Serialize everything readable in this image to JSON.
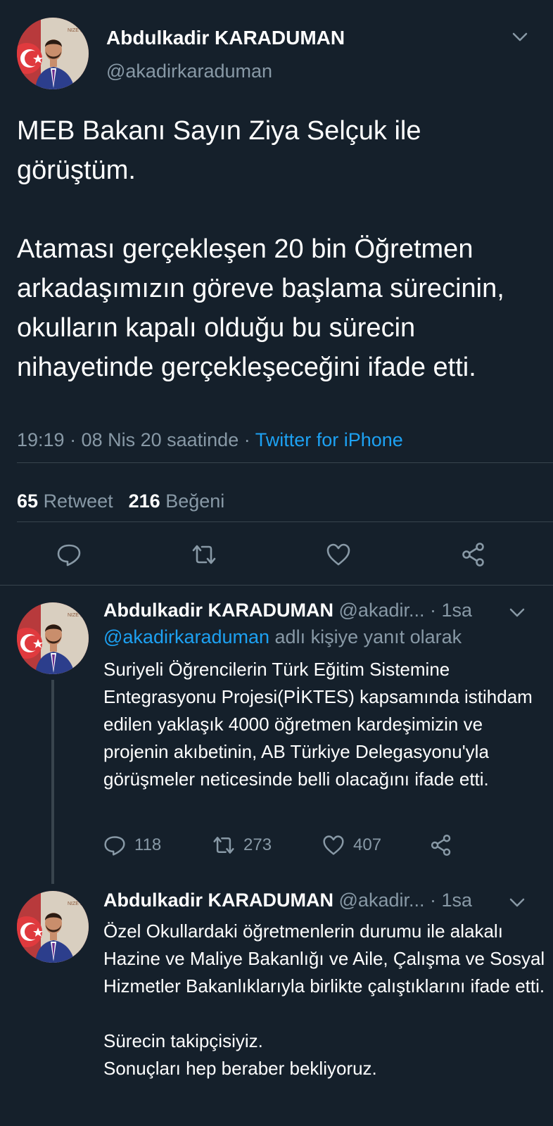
{
  "colors": {
    "background": "#15202b",
    "text_primary": "#ffffff",
    "text_secondary": "#8899a6",
    "link": "#1da1f2",
    "divider": "#38444d"
  },
  "main_tweet": {
    "author_name": "Abdulkadir KARADUMAN",
    "author_handle": "@akadirkaraduman",
    "text_paragraph_1": "MEB Bakanı Sayın Ziya Selçuk ile görüştüm.",
    "text_paragraph_2": "Ataması gerçekleşen 20 bin Öğretmen arkadaşımızın göreve başlama sürecinin, okulların kapalı olduğu bu sürecin nihayetinde gerçekleşeceğini ifade etti.",
    "timestamp": "19:19 · 08 Nis 20 saatinde · ",
    "source": "Twitter for iPhone",
    "retweet_count": "65",
    "retweet_label": "Retweet",
    "like_count": "216",
    "like_label": "Beğeni",
    "icons": [
      "reply-icon",
      "retweet-icon",
      "like-icon",
      "share-icon",
      "chevron-down-icon"
    ]
  },
  "replies": [
    {
      "author_name": "Abdulkadir KARADUMAN",
      "author_handle": "@akadir...",
      "time": "· 1sa",
      "reply_to_mention": "@akadirkaraduman",
      "reply_to_suffix": " adlı kişiye yanıt olarak",
      "text": "Suriyeli Öğrencilerin Türk Eğitim Sistemine Entegrasyonu Projesi(PİKTES) kapsamında istihdam edilen yaklaşık 4000 öğretmen kardeşimizin ve projenin akıbetinin, AB Türkiye Delegasyonu'yla görüşmeler neticesinde belli olacağını ifade etti.",
      "reply_count": "118",
      "retweet_count": "273",
      "like_count": "407"
    },
    {
      "author_name": "Abdulkadir KARADUMAN",
      "author_handle": "@akadir...",
      "time": "· 1sa",
      "text_paragraph_1": "Özel Okullardaki öğretmenlerin durumu ile alakalı Hazine ve Maliye Bakanlığı ve Aile, Çalışma ve Sosyal Hizmetler Bakanlıklarıyla birlikte çalıştıklarını ifade etti.",
      "text_paragraph_2_line_1": "Sürecin takipçisiyiz.",
      "text_paragraph_2_line_2": "Sonuçları hep beraber bekliyoruz."
    }
  ]
}
